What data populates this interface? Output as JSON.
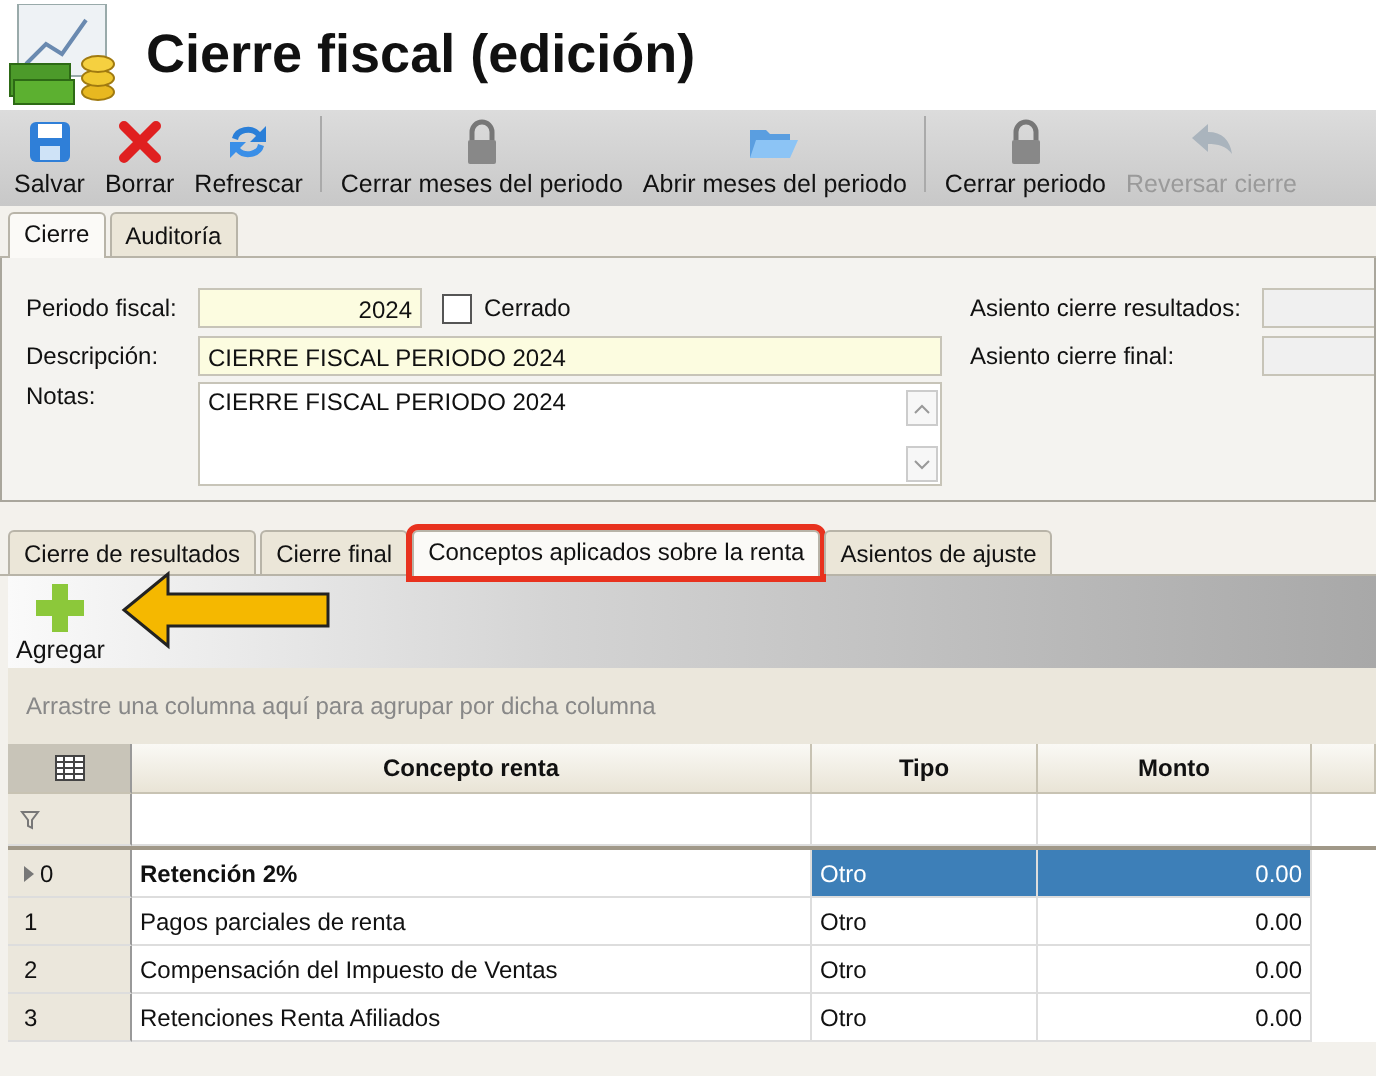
{
  "window": {
    "title": "Cierre fiscal (edición)"
  },
  "toolbar": [
    {
      "label": "Salvar",
      "kind": "save",
      "disabled": false,
      "separator_before": false
    },
    {
      "label": "Borrar",
      "kind": "delete",
      "disabled": false,
      "separator_before": false
    },
    {
      "label": "Refrescar",
      "kind": "refresh",
      "disabled": false,
      "separator_before": false
    },
    {
      "label": "Cerrar meses del periodo",
      "kind": "lock",
      "disabled": false,
      "separator_before": true
    },
    {
      "label": "Abrir meses del periodo",
      "kind": "folder",
      "disabled": false,
      "separator_before": false
    },
    {
      "label": "Cerrar periodo",
      "kind": "lock",
      "disabled": false,
      "separator_before": true
    },
    {
      "label": "Reversar cierre",
      "kind": "undo",
      "disabled": true,
      "separator_before": false
    }
  ],
  "tabs": [
    {
      "label": "Cierre",
      "selected": true
    },
    {
      "label": "Auditoría",
      "selected": false
    }
  ],
  "form": {
    "periodo_label": "Periodo fiscal:",
    "periodo_value": "2024",
    "cerrado": {
      "label": "Cerrado",
      "checked": false
    },
    "descripcion_label": "Descripción:",
    "descripcion_value": "CIERRE FISCAL PERIODO 2024",
    "notas_label": "Notas:",
    "notas_value": "CIERRE FISCAL PERIODO 2024",
    "asiento_resultados_label": "Asiento cierre resultados:",
    "asiento_final_label": "Asiento cierre final:"
  },
  "detail_tabs": [
    {
      "label": "Cierre de resultados",
      "selected": false,
      "highlighted": false
    },
    {
      "label": "Cierre final",
      "selected": false,
      "highlighted": false
    },
    {
      "label": "Conceptos aplicados sobre la renta",
      "selected": true,
      "highlighted": true
    },
    {
      "label": "Asientos de ajuste",
      "selected": false,
      "highlighted": false
    }
  ],
  "add_button": {
    "label": "Agregar",
    "pointed": true
  },
  "group_panel": "Arrastre una columna aquí para agrupar por dicha columna",
  "table": {
    "columns": [
      "Concepto renta",
      "Tipo",
      "Monto"
    ],
    "rows": [
      {
        "index": "0",
        "concepto": "Retención 2%",
        "tipo": "Otro",
        "monto": "0.00",
        "selected": true
      },
      {
        "index": "1",
        "concepto": "Pagos parciales de renta",
        "tipo": "Otro",
        "monto": "0.00",
        "selected": false
      },
      {
        "index": "2",
        "concepto": "Compensación del Impuesto de Ventas",
        "tipo": "Otro",
        "monto": "0.00",
        "selected": false
      },
      {
        "index": "3",
        "concepto": "Retenciones Renta Afiliados",
        "tipo": "Otro",
        "monto": "0.00",
        "selected": false
      }
    ]
  }
}
